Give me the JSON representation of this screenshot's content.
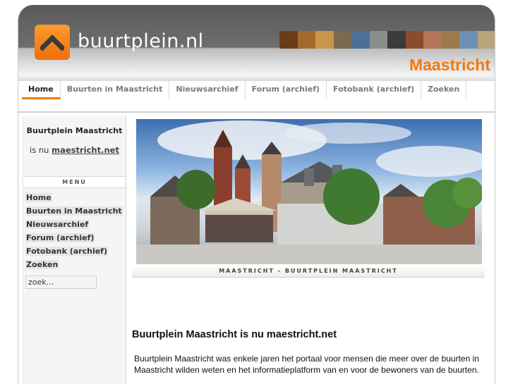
{
  "site": {
    "logo_text": "buurtplein.nl",
    "city": "Maastricht",
    "accent_color": "#f07a12",
    "logo_icon": "chevron-up-icon"
  },
  "nav": {
    "items": [
      {
        "label": "Home",
        "active": true
      },
      {
        "label": "Buurten in Maastricht"
      },
      {
        "label": "Nieuwsarchief"
      },
      {
        "label": "Forum (archief)"
      },
      {
        "label": "Fotobank (archief)"
      },
      {
        "label": "Zoeken"
      }
    ]
  },
  "sidebar": {
    "title": "Buurtplein Maastricht",
    "sub_prefix": "is nu",
    "sub_link": "maestricht.net",
    "menu_heading": "MENU",
    "menu_items": [
      "Home",
      "Buurten in Maastricht",
      "Nieuwsarchief",
      "Forum (archief)",
      "Fotobank (archief)",
      "Zoeken"
    ],
    "search_value": "zoek..."
  },
  "main": {
    "caption": "MAASTRICHT - BUURTPLEIN MAASTRICHT",
    "title": "Buurtplein Maastricht is nu maestricht.net",
    "body": "Buurtplein Maastricht was enkele jaren het portaal voor mensen die meer over de buurten in Maastricht wilden weten en het informatieplatform van en voor de bewoners van de buurten."
  }
}
